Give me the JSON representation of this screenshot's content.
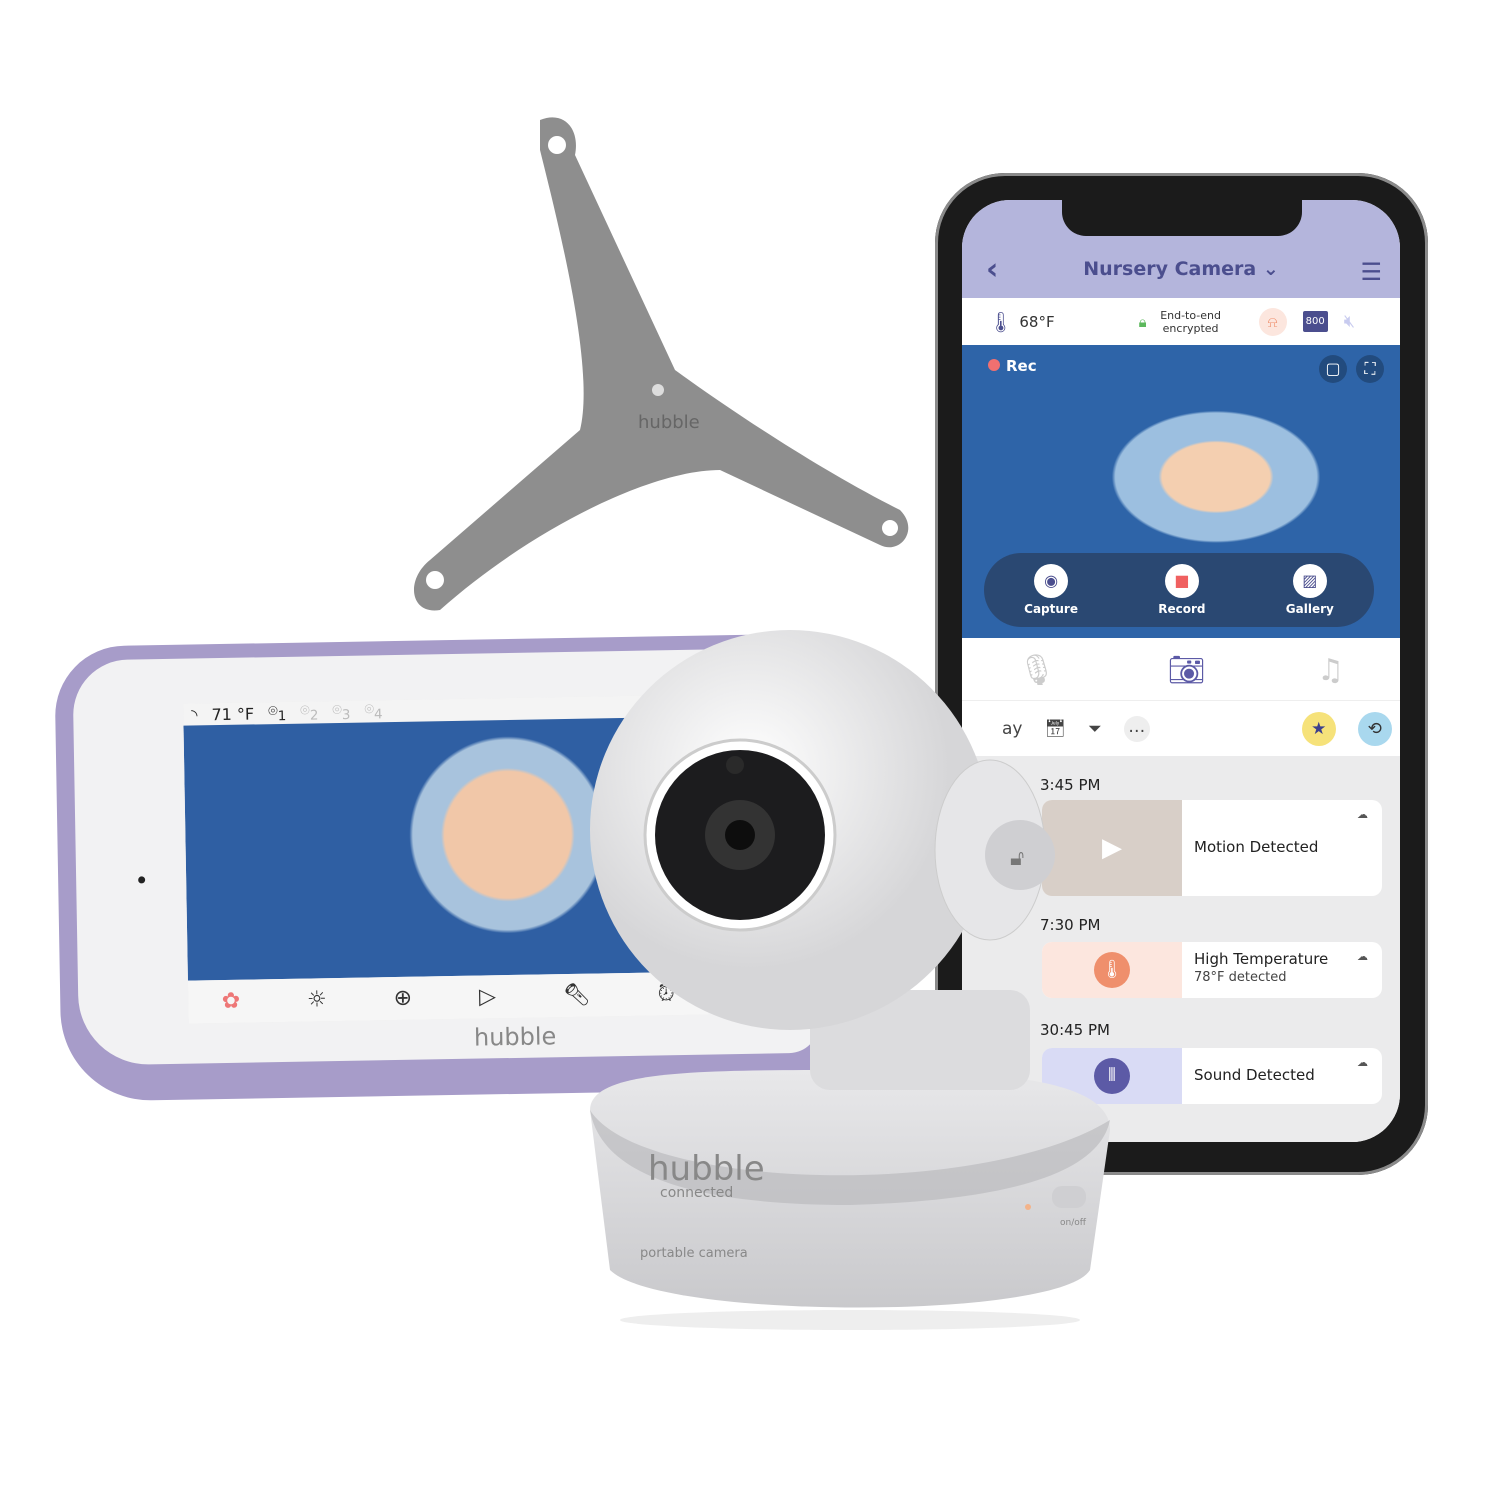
{
  "mount": {
    "brand": "hubble",
    "sub": "connected"
  },
  "monitor": {
    "temperature": "71 °F",
    "cameras": [
      "1",
      "2",
      "3",
      "4"
    ],
    "brand": "hubble",
    "toolbar_icons": [
      "apps-icon",
      "brightness-icon",
      "zoom-in-icon",
      "play-icon",
      "flashlight-icon",
      "alarm-icon",
      "playback-icon"
    ]
  },
  "camera": {
    "brand": "hubble",
    "sub": "connected",
    "label": "portable camera",
    "switch": "on/off"
  },
  "phone": {
    "header": {
      "title": "Nursery Camera",
      "back_icon": "chevron-left-icon",
      "settings_icon": "sliders-icon"
    },
    "info": {
      "temperature": "68°F",
      "encryption": "End-to-end encrypted",
      "badge": "800"
    },
    "video": {
      "rec": "Rec"
    },
    "controls": [
      {
        "label": "Capture",
        "icon": "camera-icon"
      },
      {
        "label": "Record",
        "icon": "record-icon"
      },
      {
        "label": "Gallery",
        "icon": "gallery-icon"
      }
    ],
    "filter": {
      "day": "ay"
    },
    "events": [
      {
        "time": "3:45 PM",
        "title": "Motion Detected",
        "detail": ""
      },
      {
        "time": "7:30 PM",
        "title": "High Temperature",
        "detail": "78°F  detected"
      },
      {
        "time": "30:45 PM",
        "title": "Sound Detected",
        "detail": ""
      }
    ],
    "colors": {
      "header": "#b4b5dc",
      "accent": "#4b4e8e",
      "temp_bg": "#fce6de",
      "temp_icon": "#ef8f6c",
      "sound_bg": "#d9dbf5",
      "sound_icon": "#5c5aa6"
    }
  }
}
